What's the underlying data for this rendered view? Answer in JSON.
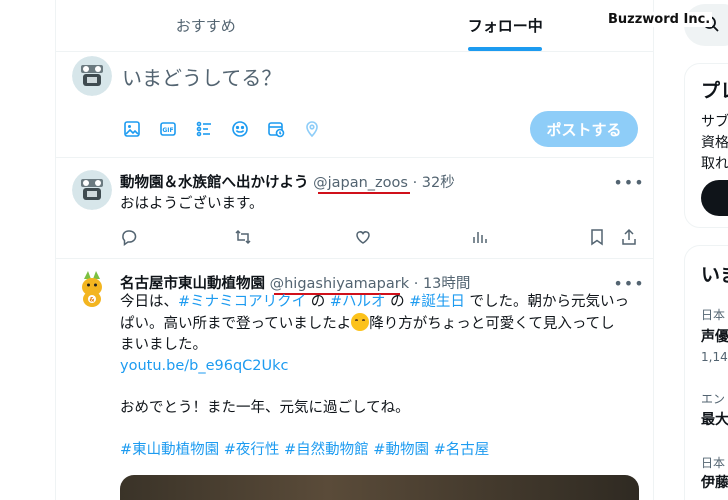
{
  "brand": "Buzzword Inc.",
  "tabs": [
    {
      "label": "おすすめ",
      "active": false
    },
    {
      "label": "フォロー中",
      "active": true
    }
  ],
  "composer": {
    "placeholder": "いまどうしてる？",
    "post_label": "ポストする",
    "tools": [
      "image-icon",
      "gif-icon",
      "poll-icon",
      "emoji-icon",
      "schedule-icon",
      "location-icon"
    ]
  },
  "tweets": [
    {
      "name": "動物園＆水族館へ出かけよう",
      "handle": "@japan_zoos",
      "dot": "·",
      "time": "32秒",
      "text": "おはようございます。"
    },
    {
      "name": "名古屋市東山動植物園",
      "handle": "@higashiyamapark",
      "dot": "·",
      "time": "13時間",
      "line1_a": "今日は、",
      "line1_tag1": "#ミナミコアリクイ",
      "line1_b": " の ",
      "line1_tag2": "#ハルオ",
      "line1_c": " の ",
      "line1_tag3": "#誕生日",
      "line1_d": " でした。朝から元気いっ",
      "line2_a": "ぱい。高い所まで登っていましたよ",
      "line2_b": "降り方がちょっと可愛くて見入ってし",
      "line3": "まいました。",
      "link": "youtu.be/b_e96qC2Ukc",
      "line5": "おめでとう！また一年、元気に過ごしてね。",
      "tags": [
        "#東山動植物園",
        "#夜行性",
        "#自然動物館",
        "#動物園",
        "#名古屋"
      ]
    }
  ],
  "right": {
    "card1": {
      "title": "プレ",
      "l1": "サブ",
      "l2": "資格",
      "l3": "取れ"
    },
    "card2": {
      "title": "いま",
      "i1_cat": "日本",
      "i1_title": "声優",
      "i1_count": "1,14",
      "i2_cat": "エン",
      "i2_title": "最大",
      "i3_cat": "日本",
      "i3_title": "伊藤"
    }
  }
}
